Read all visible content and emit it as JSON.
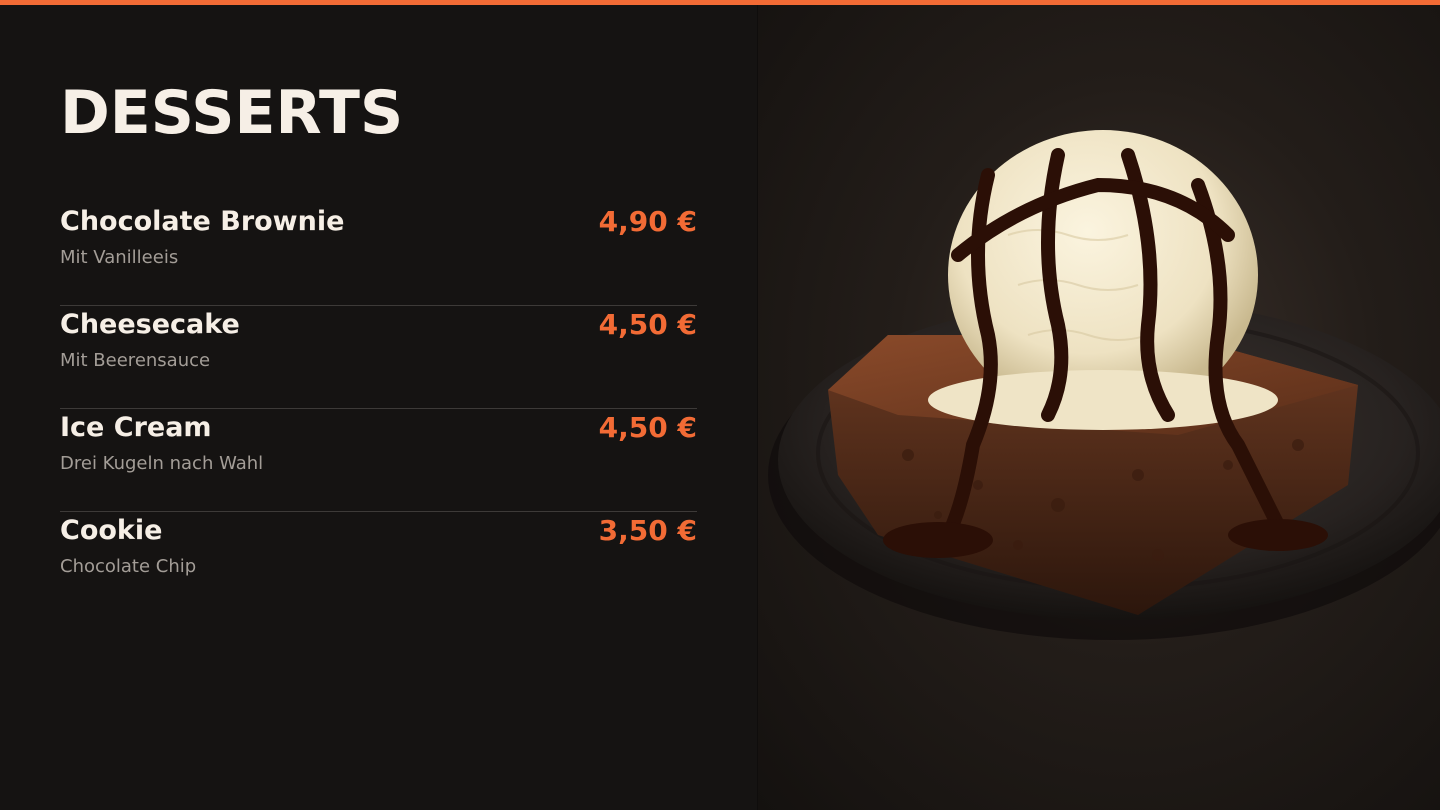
{
  "menu": {
    "title": "DESSERTS",
    "items": [
      {
        "name": "Chocolate Brownie",
        "description": "Mit Vanilleeis",
        "price": "4,90 €"
      },
      {
        "name": "Cheesecake",
        "description": "Mit Beerensauce",
        "price": "4,50 €"
      },
      {
        "name": "Ice Cream",
        "description": "Drei Kugeln nach Wahl",
        "price": "4,50 €"
      },
      {
        "name": "Cookie",
        "description": "Chocolate Chip",
        "price": "3,50 €"
      }
    ]
  },
  "photo": {
    "subject": "brownie-with-ice-cream"
  },
  "colors": {
    "accent": "#f26b35",
    "title": "#f6efe6",
    "item_name": "#f6efe6",
    "description": "#a39d97",
    "background": "#151312"
  }
}
